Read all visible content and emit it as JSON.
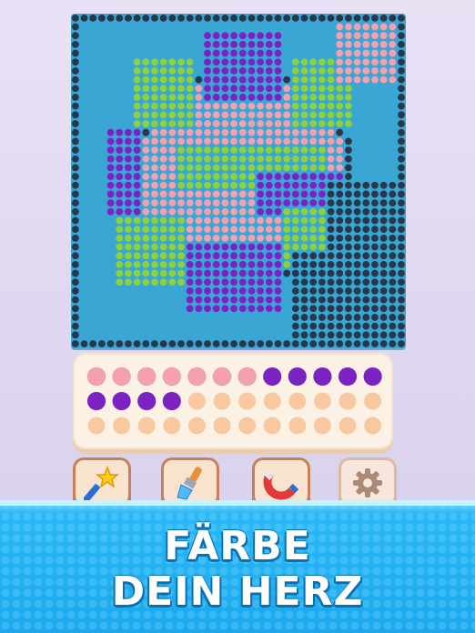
{
  "headline": {
    "line1": "FÄRBE",
    "line2": "DEIN HERZ"
  },
  "toolbar": {
    "items": [
      {
        "name": "magic-wand",
        "icon": "magic-wand-icon"
      },
      {
        "name": "paint-brush",
        "icon": "paint-brush-icon"
      },
      {
        "name": "magnet",
        "icon": "magnet-icon"
      },
      {
        "name": "settings",
        "icon": "gear-icon"
      }
    ]
  },
  "colors": {
    "board_bg": "#3aa6d4",
    "bead_blue": "#3aa6d4",
    "bead_navy": "#26384a",
    "bead_purple": "#7a22c2",
    "bead_pink": "#f4a0b0",
    "bead_green": "#8ed23a",
    "bead_peach": "#f8c9a0",
    "banner_blue": "#1aa7ec"
  },
  "bead_tray": {
    "rows": [
      [
        "pink",
        "pink",
        "pink",
        "pink",
        "pink",
        "pink",
        "pink",
        "purple",
        "purple",
        "purple",
        "purple",
        "purple"
      ],
      [
        "purple",
        "purple",
        "purple",
        "purple",
        "empty",
        "empty",
        "empty",
        "empty",
        "empty",
        "empty",
        "empty",
        "empty"
      ],
      [
        "empty",
        "empty",
        "empty",
        "empty",
        "empty",
        "empty",
        "empty",
        "empty",
        "empty",
        "empty",
        "empty",
        "empty"
      ]
    ]
  }
}
